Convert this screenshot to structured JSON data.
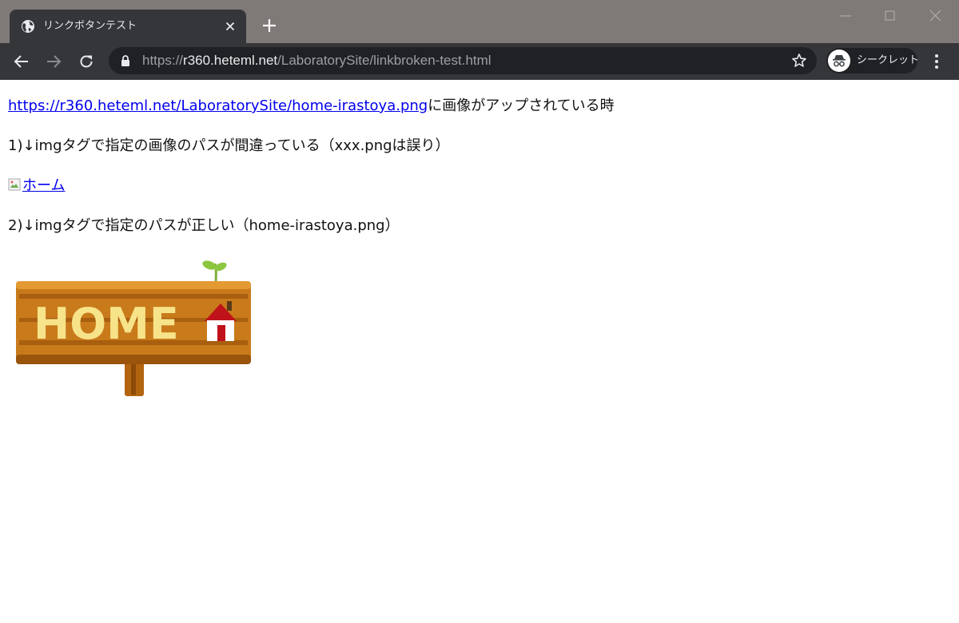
{
  "browser": {
    "tab": {
      "title": "リンクボタンテスト",
      "favicon": "globe-icon"
    },
    "url": {
      "scheme": "https://",
      "host": "r360.heteml.net",
      "path": "/LaboratorySite/linkbroken-test.html"
    },
    "incognito_label": "シークレット"
  },
  "page": {
    "line1": {
      "link": "https://r360.heteml.net/LaboratorySite/home-irastoya.png",
      "text": "に画像がアップされている時"
    },
    "line2": "1)↓imgタグで指定の画像のパスが間違っている（xxx.pngは誤り）",
    "broken_image_alt": "ホーム",
    "line3": "2)↓imgタグで指定のパスが正しい（home-irastoya.png）",
    "sign_text": "HOME"
  }
}
